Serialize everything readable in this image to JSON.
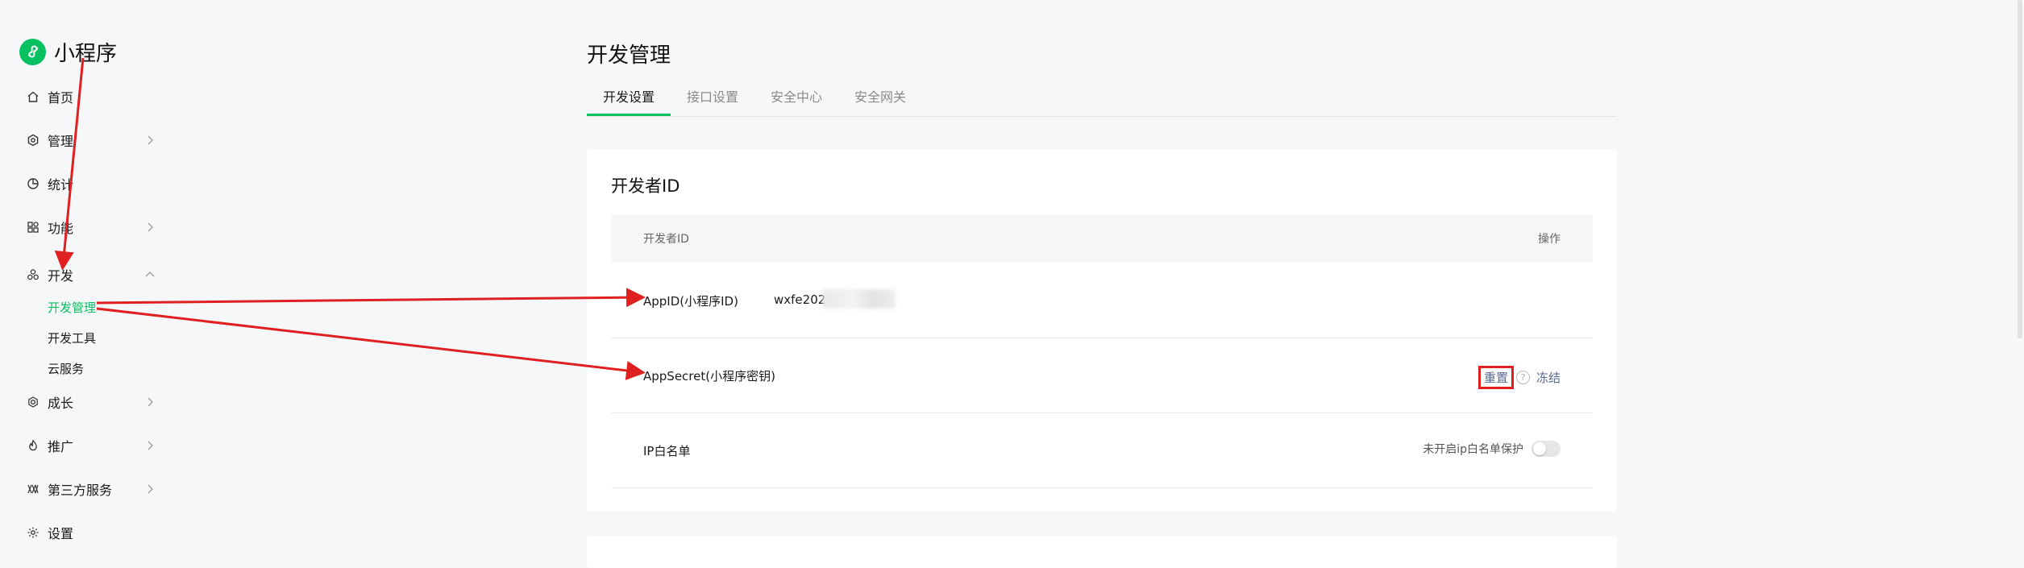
{
  "app": {
    "logo_text": "小程序",
    "brand_color": "#07c160",
    "accent_link_color": "#576b95",
    "annotation_color": "#e02020"
  },
  "sidebar": {
    "items": [
      {
        "label": "首页",
        "icon": "home-icon"
      },
      {
        "label": "管理",
        "icon": "settings-gear-icon"
      },
      {
        "label": "统计",
        "icon": "pie-chart-icon"
      },
      {
        "label": "功能",
        "icon": "grid-icon"
      },
      {
        "label": "开发",
        "icon": "dev-nodes-icon",
        "expanded": true,
        "children": [
          {
            "label": "开发管理",
            "active": true
          },
          {
            "label": "开发工具"
          },
          {
            "label": "云服务"
          }
        ]
      },
      {
        "label": "成长",
        "icon": "growth-icon"
      },
      {
        "label": "推广",
        "icon": "promotion-icon"
      },
      {
        "label": "第三方服务",
        "icon": "third-party-icon"
      },
      {
        "label": "设置",
        "icon": "gear-icon"
      }
    ]
  },
  "main": {
    "title": "开发管理",
    "tabs": [
      {
        "label": "开发设置",
        "active": true
      },
      {
        "label": "接口设置"
      },
      {
        "label": "安全中心"
      },
      {
        "label": "安全网关"
      }
    ],
    "developer_id_card": {
      "title": "开发者ID",
      "columns": [
        "开发者ID",
        "操作"
      ],
      "rows": {
        "appid": {
          "label": "AppID(小程序ID)",
          "value": "wxfe202c"
        },
        "appsecret": {
          "label": "AppSecret(小程序密钥)",
          "actions": {
            "reset": "重置",
            "help": "?",
            "freeze": "冻结"
          }
        },
        "ip_whitelist": {
          "label": "IP白名单",
          "status": "未开启ip白名单保护",
          "toggle_on": false
        }
      }
    }
  }
}
